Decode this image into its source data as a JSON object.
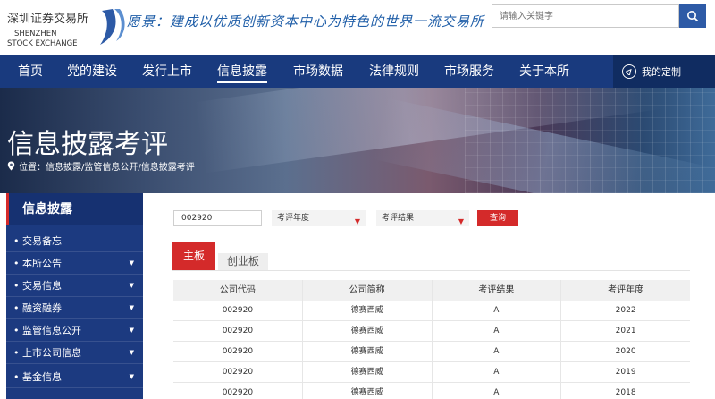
{
  "header": {
    "logo_cn": "深圳证券交易所",
    "logo_en_1": "SHENZHEN",
    "logo_en_2": "STOCK EXCHANGE",
    "slogan": "愿景：建成以优质创新资本中心为特色的世界一流交易所",
    "search_placeholder": "请输入关键字",
    "search_icon": "search-icon"
  },
  "nav": {
    "items": [
      {
        "label": "首页"
      },
      {
        "label": "党的建设"
      },
      {
        "label": "发行上市"
      },
      {
        "label": "信息披露",
        "active": true
      },
      {
        "label": "市场数据"
      },
      {
        "label": "法律规则"
      },
      {
        "label": "市场服务"
      },
      {
        "label": "关于本所"
      }
    ],
    "custom_label": "我的定制",
    "custom_icon": "compass-icon"
  },
  "banner": {
    "title": "信息披露考评",
    "breadcrumb": "位置：信息披露/监管信息公开/信息披露考评",
    "location_icon": "location-pin-icon"
  },
  "sidebar": {
    "title": "信息披露",
    "items": [
      {
        "label": "交易备忘",
        "has_arrow": false
      },
      {
        "label": "本所公告",
        "has_arrow": true
      },
      {
        "label": "交易信息",
        "has_arrow": true
      },
      {
        "label": "融资融券",
        "has_arrow": true
      },
      {
        "label": "监管信息公开",
        "has_arrow": true
      },
      {
        "label": "上市公司信息",
        "has_arrow": true
      },
      {
        "label": "基金信息",
        "has_arrow": true
      }
    ]
  },
  "filters": {
    "code_value": "002920",
    "year_label": "考评年度",
    "result_label": "考评结果",
    "query_label": "查询"
  },
  "tabs": {
    "main": "主板",
    "gem": "创业板"
  },
  "table": {
    "headers": [
      "公司代码",
      "公司简称",
      "考评结果",
      "考评年度"
    ],
    "rows": [
      [
        "002920",
        "德赛西威",
        "A",
        "2022"
      ],
      [
        "002920",
        "德赛西威",
        "A",
        "2021"
      ],
      [
        "002920",
        "德赛西威",
        "A",
        "2020"
      ],
      [
        "002920",
        "德赛西威",
        "A",
        "2019"
      ],
      [
        "002920",
        "德赛西威",
        "A",
        "2018"
      ]
    ]
  },
  "colors": {
    "nav_bg": "#193a7e",
    "accent_red": "#d42a2a",
    "brand_blue": "#2d5aa6"
  }
}
